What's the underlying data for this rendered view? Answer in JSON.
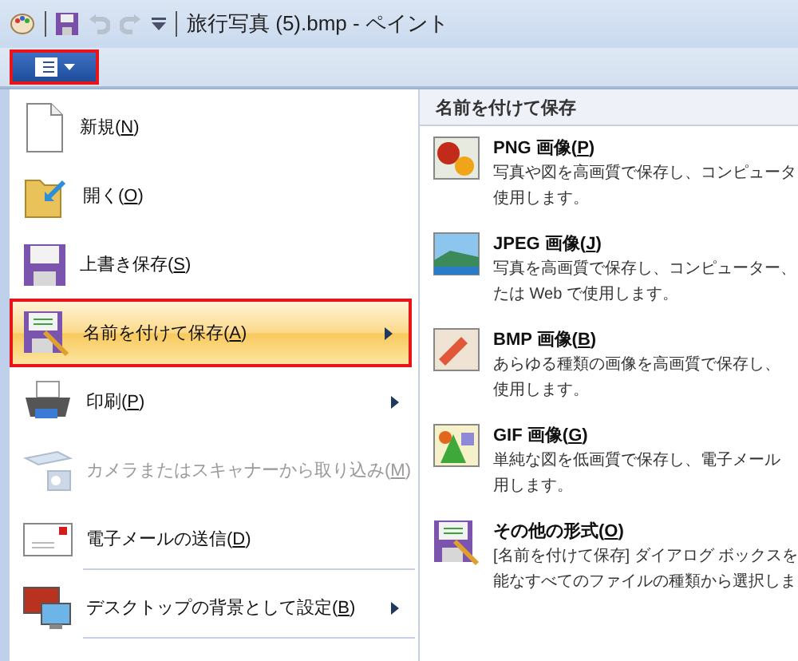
{
  "window": {
    "title": "旅行写真 (5).bmp - ペイント"
  },
  "quick_access": [
    {
      "kind": "save",
      "disabled": false
    },
    {
      "kind": "undo",
      "disabled": true
    },
    {
      "kind": "redo",
      "disabled": true
    },
    {
      "kind": "customize",
      "disabled": false
    }
  ],
  "menu_button": {
    "highlighted": true
  },
  "file_menu": {
    "items": [
      {
        "kind": "new",
        "before": "新規(",
        "accel": "N",
        "after": ")",
        "selected": false,
        "disabled": false,
        "submenu": false,
        "divider_below": false
      },
      {
        "kind": "open",
        "before": "開く(",
        "accel": "O",
        "after": ")",
        "selected": false,
        "disabled": false,
        "submenu": false,
        "divider_below": false
      },
      {
        "kind": "save",
        "before": "上書き保存(",
        "accel": "S",
        "after": ")",
        "selected": false,
        "disabled": false,
        "submenu": false,
        "divider_below": false
      },
      {
        "kind": "saveas",
        "before": "名前を付けて保存(",
        "accel": "A",
        "after": ")",
        "selected": true,
        "disabled": false,
        "submenu": true,
        "divider_below": false
      },
      {
        "kind": "print",
        "before": "印刷(",
        "accel": "P",
        "after": ")",
        "selected": false,
        "disabled": false,
        "submenu": true,
        "divider_below": false
      },
      {
        "kind": "scanner",
        "before": "カメラまたはスキャナーから取り込み(",
        "accel": "M",
        "after": ")",
        "selected": false,
        "disabled": true,
        "submenu": false,
        "divider_below": false
      },
      {
        "kind": "email",
        "before": "電子メールの送信(",
        "accel": "D",
        "after": ")",
        "selected": false,
        "disabled": false,
        "submenu": false,
        "divider_below": true
      },
      {
        "kind": "desktop",
        "before": "デスクトップの背景として設定(",
        "accel": "B",
        "after": ")",
        "selected": false,
        "disabled": false,
        "submenu": true,
        "divider_below": true
      }
    ]
  },
  "submenu": {
    "title": "名前を付けて保存",
    "items": [
      {
        "kind": "png",
        "before": "PNG 画像(",
        "accel": "P",
        "after": ")",
        "lines": [
          "写真や図を高画質で保存し、コンピュータ",
          "使用します。"
        ]
      },
      {
        "kind": "jpeg",
        "before": "JPEG 画像(",
        "accel": "J",
        "after": ")",
        "lines": [
          "写真を高画質で保存し、コンピューター、",
          "たは Web で使用します。"
        ]
      },
      {
        "kind": "bmp",
        "before": "BMP 画像(",
        "accel": "B",
        "after": ")",
        "lines": [
          "あらゆる種類の画像を高画質で保存し、",
          "使用します。"
        ]
      },
      {
        "kind": "gif",
        "before": "GIF 画像(",
        "accel": "G",
        "after": ")",
        "lines": [
          "単純な図を低画質で保存し、電子メール",
          "用します。"
        ]
      },
      {
        "kind": "other",
        "before": "その他の形式(",
        "accel": "O",
        "after": ")",
        "lines": [
          "[名前を付けて保存] ダイアログ ボックスを",
          "能なすべてのファイルの種類から選択しま"
        ]
      }
    ]
  }
}
